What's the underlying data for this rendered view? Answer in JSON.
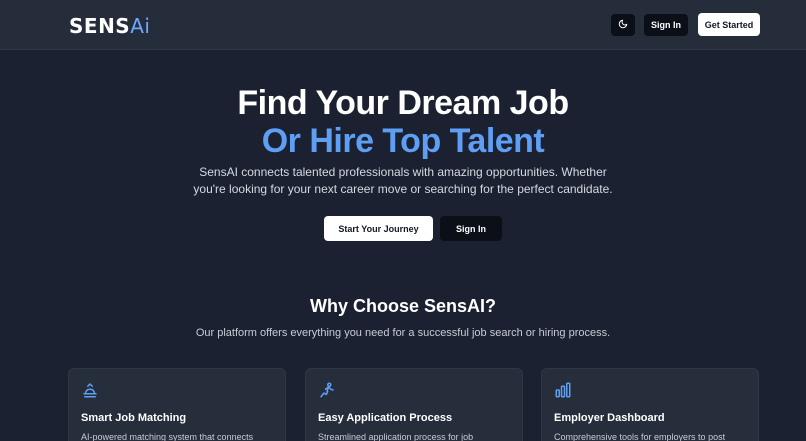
{
  "header": {
    "logo_main": "SENS",
    "logo_ai": "Ai",
    "signin_label": "Sign In",
    "getstarted_label": "Get Started",
    "theme_icon": "moon-icon"
  },
  "hero": {
    "title_line1": "Find Your Dream Job",
    "title_line2": "Or Hire Top Talent",
    "description": "SensAI connects talented professionals with amazing opportunities. Whether you're looking for your next career move or searching for the perfect candidate.",
    "primary_cta": "Start Your Journey",
    "secondary_cta": "Sign In"
  },
  "features": {
    "title": "Why Choose SensAI?",
    "subtitle": "Our platform offers everything you need for a successful job search or hiring process.",
    "cards": [
      {
        "icon": "handshake-icon",
        "title": "Smart Job Matching",
        "description": "AI-powered matching system that connects"
      },
      {
        "icon": "person-run-icon",
        "title": "Easy Application Process",
        "description": "Streamlined application process for job"
      },
      {
        "icon": "bar-chart-icon",
        "title": "Employer Dashboard",
        "description": "Comprehensive tools for employers to post"
      }
    ]
  },
  "colors": {
    "background": "#1b2130",
    "header": "#252c3a",
    "accent": "#5f9ef5",
    "card": "#262d3b"
  }
}
